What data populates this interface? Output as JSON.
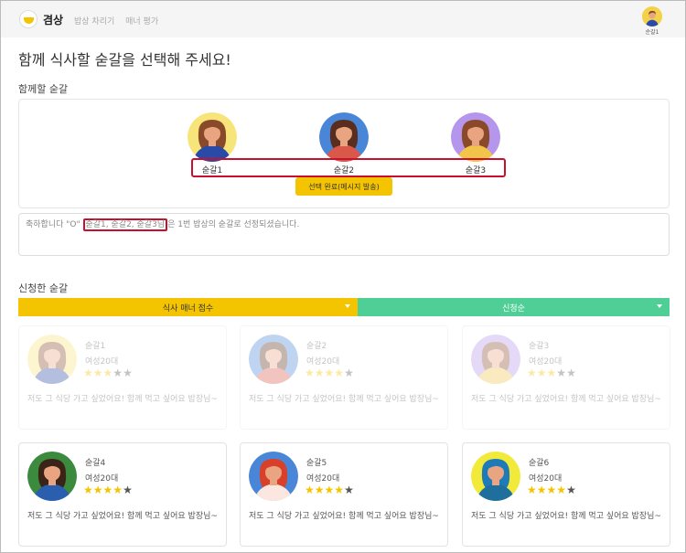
{
  "header": {
    "logo_text": "겸상",
    "nav": [
      "밥상 차리기",
      "매너 평가"
    ],
    "profile_label": "순갈1"
  },
  "page_title": "함께 식사할 숟갈을 선택해 주세요!",
  "selected_section": {
    "label": "함께할 숟갈",
    "members": [
      {
        "name": "숟갈1",
        "bg": "#f7e57a",
        "hair": "#8a4a2a",
        "shirt": "#2a4aa8",
        "skin": "#e9a582"
      },
      {
        "name": "숟갈2",
        "bg": "#4a86d8",
        "hair": "#5a2e1e",
        "shirt": "#d9584a",
        "skin": "#e9a582"
      },
      {
        "name": "숟갈3",
        "bg": "#b596ec",
        "hair": "#8a4a2a",
        "shirt": "#f3c44a",
        "skin": "#e9a582"
      }
    ],
    "done_button": "선택 완료(메시지 발송)"
  },
  "message": {
    "prefix": "축하합니다 \"O\"",
    "highlight": "숟갈1, 숟갈2, 숟갈3님",
    "suffix": "은 1번 밥상의 숟갈로 선정되셨습니다."
  },
  "applicants_section": {
    "label": "신청한 숟갈",
    "sort_manner": "식사 매너 점수",
    "sort_apply": "신청순"
  },
  "cards": [
    {
      "name": "숟갈1",
      "age": "여성20대",
      "rating": 3,
      "desc": "저도 그 식당 가고 싶었어요! 함께 먹고 싶어요 밥장님~",
      "dim": true,
      "bg": "#f7e57a",
      "hair": "#8a4a2a",
      "shirt": "#2a4aa8"
    },
    {
      "name": "숟갈2",
      "age": "여성20대",
      "rating": 3.5,
      "desc": "저도 그 식당 가고 싶었어요! 함께 먹고 싶어요 밥장님~",
      "dim": true,
      "bg": "#4a86d8",
      "hair": "#5a2e1e",
      "shirt": "#d9584a"
    },
    {
      "name": "숟갈3",
      "age": "여성20대",
      "rating": 3,
      "desc": "저도 그 식당 가고 싶었어요! 함께 먹고 싶어요 밥장님~",
      "dim": true,
      "bg": "#b596ec",
      "hair": "#8a4a2a",
      "shirt": "#f3c44a"
    },
    {
      "name": "숟갈4",
      "age": "여성20대",
      "rating": 4,
      "desc": "저도 그 식당 가고 싶었어요! 함께 먹고 싶어요 밥장님~",
      "dim": false,
      "bg": "#3b8a3e",
      "hair": "#3a2418",
      "shirt": "#2a5fb0"
    },
    {
      "name": "숟갈5",
      "age": "여성20대",
      "rating": 3.5,
      "desc": "저도 그 식당 가고 싶었어요! 함께 먹고 싶어요 밥장님~",
      "dim": false,
      "bg": "#4a86d8",
      "hair": "#d9402a",
      "shirt": "#fbe7e0"
    },
    {
      "name": "숟갈6",
      "age": "여성20대",
      "rating": 4,
      "desc": "저도 그 식당 가고 싶었어요! 함께 먹고 싶어요 밥장님~",
      "dim": false,
      "bg": "#f2ea3a",
      "hair": "#1f7ab8",
      "shirt": "#1f6f9e"
    }
  ]
}
